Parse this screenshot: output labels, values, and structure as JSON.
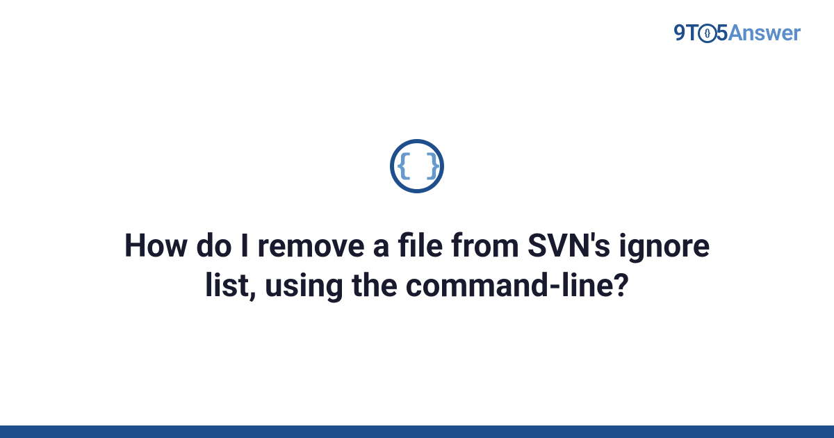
{
  "logo": {
    "part1": "9T",
    "circle_glyph": "{}",
    "part2": "5",
    "part3": "Answer"
  },
  "icon": {
    "name": "code-braces-icon",
    "glyph": "{ }"
  },
  "title": "How do I remove a file from SVN's ignore list, using the command-line?",
  "colors": {
    "brand_dark": "#1e4f8c",
    "brand_light": "#5a8dc9",
    "icon_inner": "#6699cc",
    "text": "#1a1a2e"
  }
}
